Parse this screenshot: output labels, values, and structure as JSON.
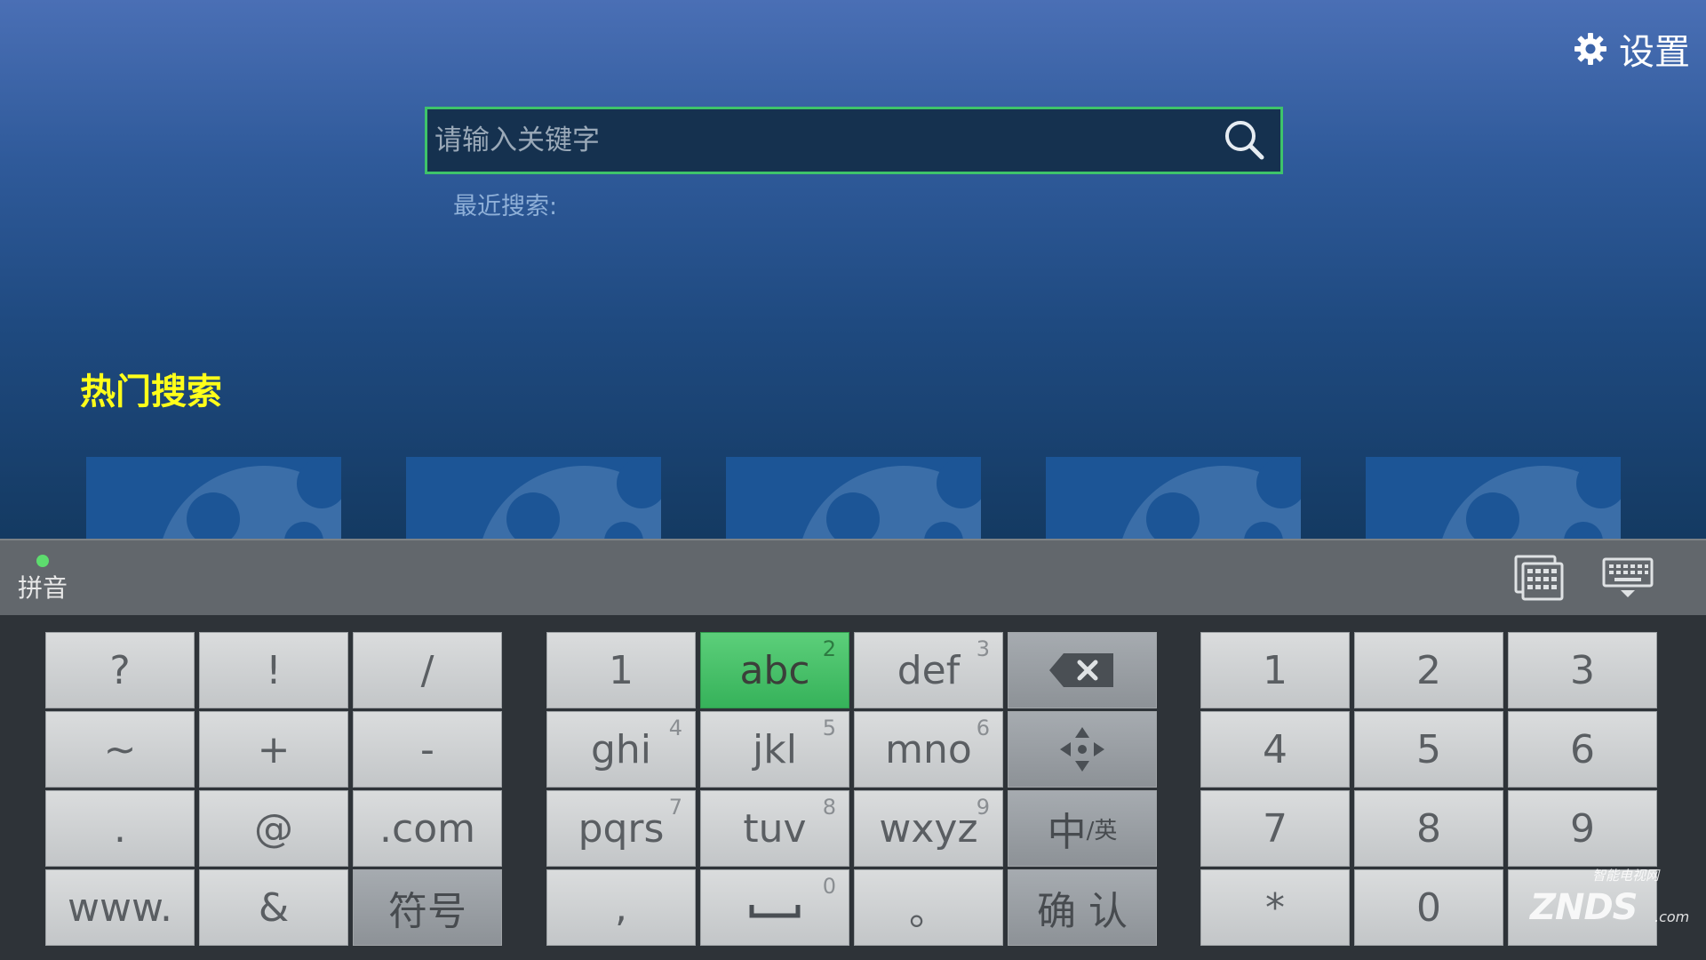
{
  "header": {
    "settings_label": "设置",
    "settings_icon": "gear-icon"
  },
  "search": {
    "placeholder": "请输入关键字",
    "value": "",
    "icon": "search-icon",
    "border_color": "#3ec46a"
  },
  "recent": {
    "label": "最近搜索:"
  },
  "hot": {
    "title": "热门搜索",
    "title_color": "#ffff1a",
    "tiles": [
      "thumbnail-placeholder",
      "thumbnail-placeholder",
      "thumbnail-placeholder",
      "thumbnail-placeholder",
      "thumbnail-placeholder"
    ]
  },
  "ime": {
    "mode_label": "拼音",
    "mode_indicator_color": "#5ddc6e",
    "icons": [
      "keyboard-layout-icon",
      "keyboard-hide-icon"
    ]
  },
  "keyboard": {
    "symbols": [
      [
        "?",
        "!",
        "/"
      ],
      [
        "~",
        "+",
        "-"
      ],
      [
        ".",
        "@",
        ".com"
      ],
      [
        "www.",
        "&",
        "符号"
      ]
    ],
    "t9": [
      [
        {
          "label": "1",
          "sub": ""
        },
        {
          "label": "abc",
          "sub": "2"
        },
        {
          "label": "def",
          "sub": "3"
        },
        {
          "label": "",
          "sub": "",
          "icon": "backspace-icon"
        }
      ],
      [
        {
          "label": "ghi",
          "sub": "4"
        },
        {
          "label": "jkl",
          "sub": "5"
        },
        {
          "label": "mno",
          "sub": "6"
        },
        {
          "label": "",
          "sub": "",
          "icon": "move-arrows-icon"
        }
      ],
      [
        {
          "label": "pqrs",
          "sub": "7"
        },
        {
          "label": "tuv",
          "sub": "8"
        },
        {
          "label": "wxyz",
          "sub": "9"
        },
        {
          "label": "中",
          "sub": "",
          "label_small": "/英"
        }
      ],
      [
        {
          "label": ",",
          "sub": ""
        },
        {
          "label": "␣",
          "sub": "0",
          "icon": "space-icon"
        },
        {
          "label": "。",
          "sub": ""
        },
        {
          "label": "确 认",
          "sub": ""
        }
      ]
    ],
    "numpad": [
      [
        "1",
        "2",
        "3"
      ],
      [
        "4",
        "5",
        "6"
      ],
      [
        "7",
        "8",
        "9"
      ],
      [
        "*",
        "0",
        ""
      ]
    ],
    "active_key": "abc",
    "active_color": "#36b25a"
  },
  "watermark": {
    "main": "ZNDS",
    "sub": "智能电视网",
    "suffix": ".com"
  }
}
